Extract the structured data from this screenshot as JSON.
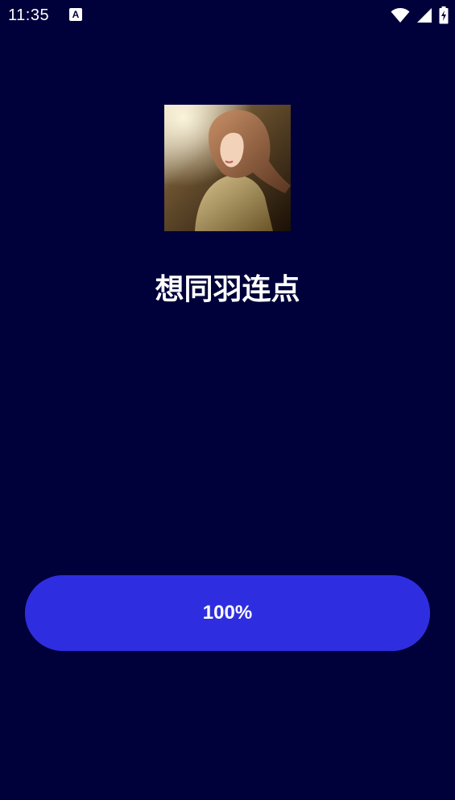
{
  "status_bar": {
    "time": "11:35",
    "notification_icon": "A",
    "icons": [
      "wifi-icon",
      "signal-icon",
      "battery-icon"
    ]
  },
  "player": {
    "album_art": "album-art-image",
    "title": "想同羽连点"
  },
  "progress": {
    "label": "100%",
    "fraction": 1.0,
    "color": "#2e2ee0"
  },
  "colors": {
    "background": "#00003a",
    "accent": "#2e2ee0",
    "text": "#ffffff"
  }
}
